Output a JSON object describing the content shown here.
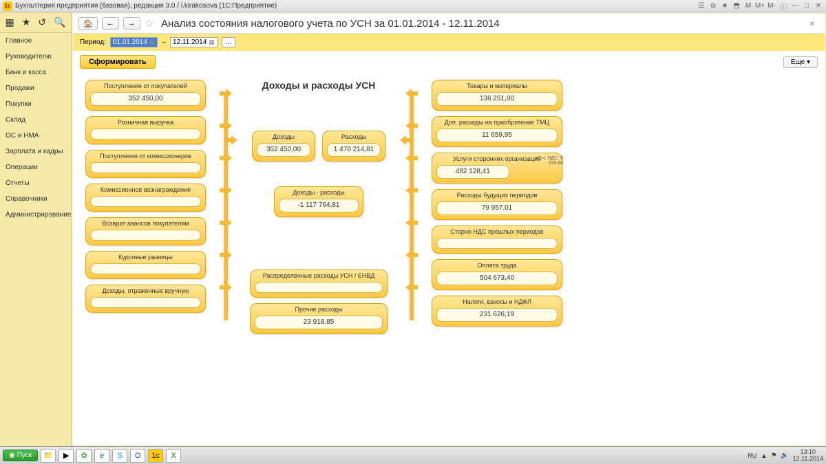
{
  "titlebar": {
    "app_title": "Бухгалтерия предприятия (базовая), редакция 3.0 / i.kirakosova  (1С:Предприятие)"
  },
  "sidebar": {
    "items": [
      {
        "label": "Главное"
      },
      {
        "label": "Руководителю"
      },
      {
        "label": "Банк и касса"
      },
      {
        "label": "Продажи"
      },
      {
        "label": "Покупки"
      },
      {
        "label": "Склад"
      },
      {
        "label": "ОС и НМА"
      },
      {
        "label": "Зарплата и кадры"
      },
      {
        "label": "Операции"
      },
      {
        "label": "Отчеты"
      },
      {
        "label": "Справочники"
      },
      {
        "label": "Администрирование"
      }
    ]
  },
  "header": {
    "page_title": "Анализ состояния налогового учета по УСН за 01.01.2014 - 12.11.2014"
  },
  "period": {
    "label": "Период:",
    "from": "01.01.2014",
    "separator": "–",
    "to": "12.11.2014"
  },
  "actions": {
    "form": "Сформировать",
    "more": "Еще"
  },
  "diagram": {
    "title": "Доходы и расходы УСН",
    "left": [
      {
        "title": "Поступления от покупателей",
        "value": "352 450,00"
      },
      {
        "title": "Розничная выручка",
        "value": ""
      },
      {
        "title": "Поступления от комиссионеров",
        "value": ""
      },
      {
        "title": "Комиссионное вознаграждение",
        "value": ""
      },
      {
        "title": "Возврат авансов покупателям",
        "value": ""
      },
      {
        "title": "Курсовые разницы",
        "value": ""
      },
      {
        "title": "Доходы, отраженные вручную",
        "value": ""
      }
    ],
    "mid_top": [
      {
        "title": "Доходы",
        "value": "352 450,00"
      },
      {
        "title": "Расходы",
        "value": "1 470 214,81"
      }
    ],
    "mid_diff": {
      "title": "Доходы - расходы",
      "value": "-1 117 764,81"
    },
    "mid_bottom": [
      {
        "title": "Распределенные расходы УСН / ЕНВД",
        "value": ""
      },
      {
        "title": "Прочие расходы",
        "value": "23 918,85"
      }
    ],
    "right": [
      {
        "title": "Товары и материалы",
        "value": "136 251,00"
      },
      {
        "title": "Доп. расходы на приобретение ТМЦ",
        "value": "11 659,95"
      },
      {
        "title": "Услуги сторонних организаций",
        "value": "482 128,41",
        "note": "в т.ч. НДС: 6 233,60"
      },
      {
        "title": "Расходы будущих периодов",
        "value": "79 957,01"
      },
      {
        "title": "Сторно НДС прошлых периодов",
        "value": ""
      },
      {
        "title": "Оплата труда",
        "value": "504 673,40"
      },
      {
        "title": "Налоги, взносы и НДФЛ",
        "value": "231 626,19"
      }
    ]
  },
  "taskbar": {
    "start": "Пуск",
    "lang": "RU",
    "time": "13:10",
    "date": "12.11.2014"
  }
}
